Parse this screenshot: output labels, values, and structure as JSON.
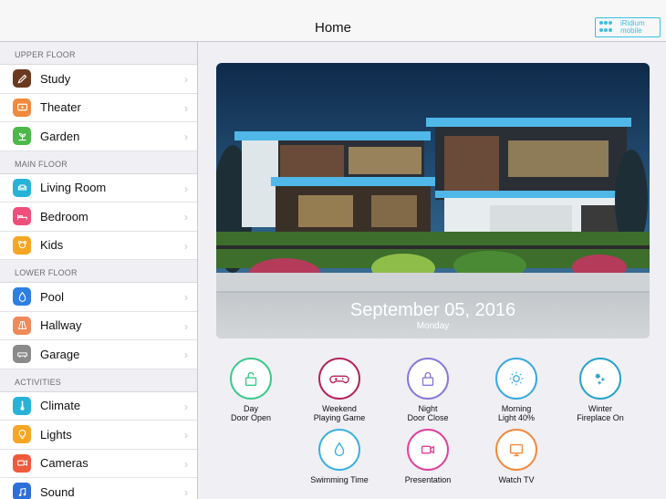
{
  "header": {
    "title": "Home",
    "logo_text": "iRidium mobile",
    "logo_line1": "iRidium",
    "logo_line2": "mobile"
  },
  "sidebar": {
    "sections": [
      {
        "title": "UPPER FLOOR",
        "items": [
          {
            "label": "Study",
            "icon": "pencil-icon",
            "color": "#6b3a1e"
          },
          {
            "label": "Theater",
            "icon": "theater-icon",
            "color": "#f08a3c"
          },
          {
            "label": "Garden",
            "icon": "garden-icon",
            "color": "#4cb849"
          }
        ]
      },
      {
        "title": "MAIN FLOOR",
        "items": [
          {
            "label": "Living Room",
            "icon": "sofa-icon",
            "color": "#27b3d8"
          },
          {
            "label": "Bedroom",
            "icon": "bed-icon",
            "color": "#ef4f7a"
          },
          {
            "label": "Kids",
            "icon": "kids-icon",
            "color": "#f5a623"
          }
        ]
      },
      {
        "title": "LOWER FLOOR",
        "items": [
          {
            "label": "Pool",
            "icon": "drop-icon",
            "color": "#2d7fe0"
          },
          {
            "label": "Hallway",
            "icon": "hallway-icon",
            "color": "#ef8a5a"
          },
          {
            "label": "Garage",
            "icon": "garage-icon",
            "color": "#8a8a8a"
          }
        ]
      },
      {
        "title": "ACTIVITIES",
        "items": [
          {
            "label": "Climate",
            "icon": "thermometer-icon",
            "color": "#27b3d8"
          },
          {
            "label": "Lights",
            "icon": "bulb-icon",
            "color": "#f5a623"
          },
          {
            "label": "Cameras",
            "icon": "camera-icon",
            "color": "#f05a3c"
          },
          {
            "label": "Sound",
            "icon": "music-icon",
            "color": "#2d6fd8"
          }
        ]
      }
    ]
  },
  "hero": {
    "date": "September 05, 2016",
    "day": "Monday"
  },
  "scenes": [
    {
      "line1": "Day",
      "line2": "Door Open",
      "icon": "unlock-icon",
      "color": "#3cc98a"
    },
    {
      "line1": "Weekend",
      "line2": "Playing Game",
      "icon": "gamepad-icon",
      "color": "#b5235a"
    },
    {
      "line1": "Night",
      "line2": "Door Close",
      "icon": "lock-icon",
      "color": "#8a78d8"
    },
    {
      "line1": "Morning",
      "line2": "Light 40%",
      "icon": "sun-icon",
      "color": "#3aa8e0"
    },
    {
      "line1": "Winter",
      "line2": "Fireplace On",
      "icon": "snowflake-icon",
      "color": "#27a3c8"
    },
    {
      "line1": "Swimming Time",
      "line2": "",
      "icon": "drop-icon",
      "color": "#3ab0e0"
    },
    {
      "line1": "Presentation",
      "line2": "",
      "icon": "video-icon",
      "color": "#e0409a"
    },
    {
      "line1": "Watch TV",
      "line2": "",
      "icon": "tv-icon",
      "color": "#f08a3c"
    }
  ]
}
